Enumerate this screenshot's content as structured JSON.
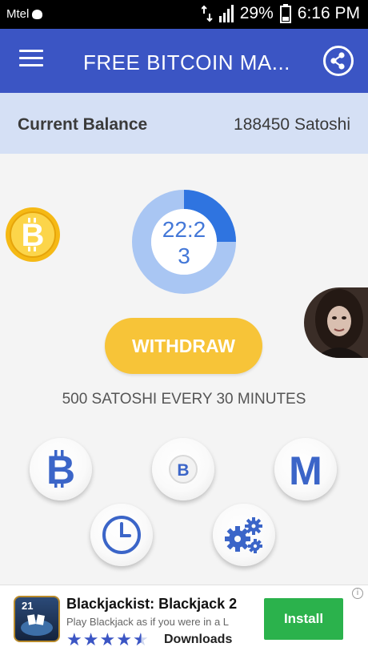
{
  "status_bar": {
    "carrier": "Mtel",
    "battery": "29%",
    "time": "6:16 PM"
  },
  "app_bar": {
    "title": "FREE BITCOIN MA...",
    "menu_icon": "hamburger-menu-icon",
    "share_icon": "share-icon",
    "color": "#3b55c4"
  },
  "balance": {
    "label": "Current Balance",
    "value": "188450 Satoshi"
  },
  "timer": {
    "line1": "22:2",
    "line2": "3",
    "progress": 0.25
  },
  "withdraw_label": "WITHDRAW",
  "tagline": "500 SATOSHI EVERY 30 MINUTES",
  "actions": [
    {
      "icon": "bitcoin-b-icon"
    },
    {
      "icon": "bitcoin-coin-icon"
    },
    {
      "icon": "letter-m-icon"
    },
    {
      "icon": "clock-icon"
    },
    {
      "icon": "gears-icon"
    }
  ],
  "ad": {
    "icon_text": "21",
    "title": "Blackjackist: Blackjack 2",
    "description": "Play Blackjack as if you were in a L",
    "rating": 4.5,
    "downloads_label": "Downloads",
    "install_label": "Install",
    "info_label": "i"
  },
  "colors": {
    "accent_blue": "#3b55c4",
    "balance_bg": "#d5e0f5",
    "withdraw_yellow": "#f7c438",
    "install_green": "#2bb24c"
  }
}
